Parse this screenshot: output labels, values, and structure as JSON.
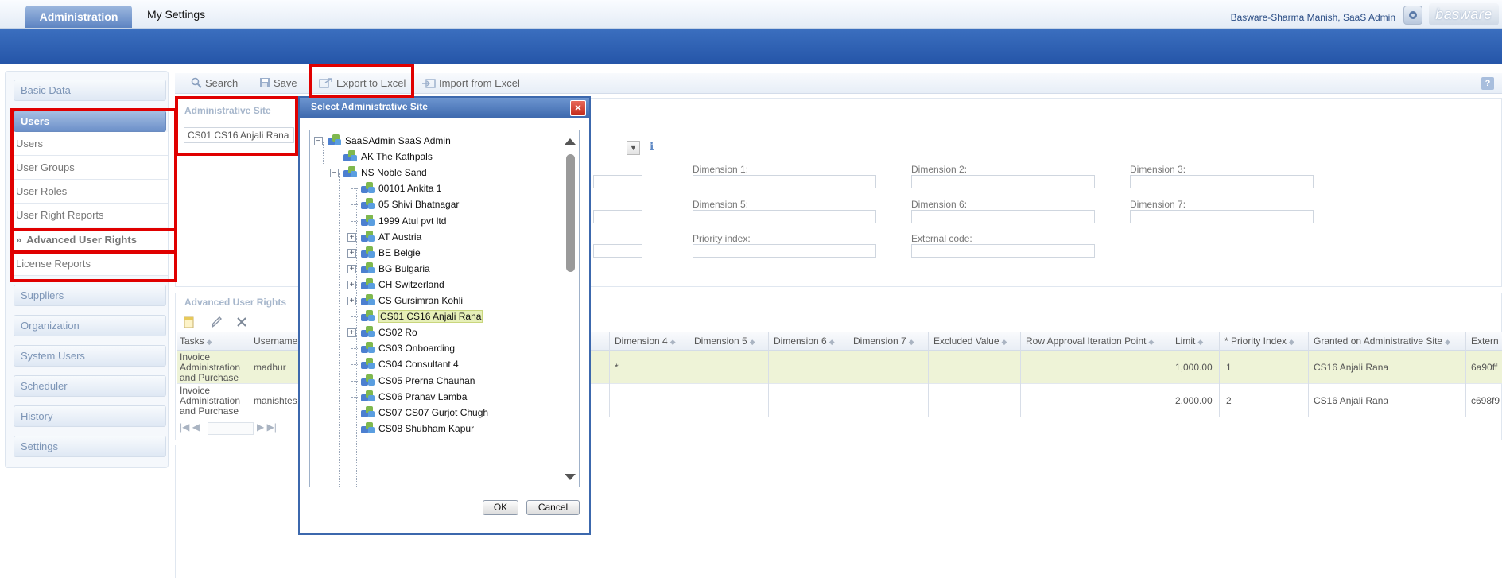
{
  "header": {
    "tabs": [
      {
        "label": "Administration",
        "active": true
      },
      {
        "label": "My Settings",
        "active": false
      }
    ],
    "user": "Basware-Sharma Manish, SaaS Admin",
    "logo_text": "basware"
  },
  "sidebar": {
    "items": [
      {
        "label": "Basic Data"
      },
      {
        "label": "Users"
      },
      {
        "label": "Suppliers"
      },
      {
        "label": "Organization"
      },
      {
        "label": "System Users"
      },
      {
        "label": "Scheduler"
      },
      {
        "label": "History"
      },
      {
        "label": "Settings"
      }
    ],
    "users_sub": [
      {
        "label": "Users"
      },
      {
        "label": "User Groups"
      },
      {
        "label": "User Roles"
      },
      {
        "label": "User Right Reports"
      },
      {
        "label": "Advanced User Rights"
      },
      {
        "label": "License Reports"
      }
    ],
    "selected_marker": "»"
  },
  "toolbar": {
    "search": "Search",
    "save": "Save",
    "export": "Export to Excel",
    "import": "Import from Excel",
    "help": "?"
  },
  "form": {
    "site_title": "Administrative Site",
    "site_value": "CS01 CS16 Anjali Rana",
    "labels": {
      "dim1": "Dimension 1:",
      "dim2": "Dimension 2:",
      "dim3": "Dimension 3:",
      "dim5": "Dimension 5:",
      "dim6": "Dimension 6:",
      "dim7": "Dimension 7:",
      "priority": "Priority index:",
      "external": "External code:"
    }
  },
  "grid": {
    "title": "Advanced User Rights",
    "columns": {
      "tasks": "Tasks",
      "username": "Username",
      "dim4": "Dimension 4",
      "dim5": "Dimension 5",
      "dim6": "Dimension 6",
      "dim7": "Dimension 7",
      "excluded": "Excluded Value",
      "row_approval": "Row Approval Iteration Point",
      "limit": "Limit",
      "priority": "* Priority Index",
      "granted": "Granted on Administrative Site",
      "external": "Extern"
    },
    "rows": [
      {
        "tasks": "Invoice Administration and Purchase",
        "username": "madhur",
        "dim4": "*",
        "limit": "1,000.00",
        "priority": "1",
        "granted": "CS16 Anjali Rana",
        "external": "6a90ff"
      },
      {
        "tasks": "Invoice Administration and Purchase",
        "username": "manishtes",
        "dim4": "",
        "limit": "2,000.00",
        "priority": "2",
        "granted": "CS16 Anjali Rana",
        "external": "c698f9"
      }
    ]
  },
  "dialog": {
    "title": "Select Administrative Site",
    "close": "×",
    "tree": [
      {
        "label": "SaaSAdmin SaaS Admin",
        "level": 0,
        "expander": "−"
      },
      {
        "label": "AK The Kathpals",
        "level": 1,
        "expander": ""
      },
      {
        "label": "NS Noble Sand",
        "level": 1,
        "expander": "−"
      },
      {
        "label": "00101 Ankita 1",
        "level": 2,
        "expander": ""
      },
      {
        "label": "05 Shivi Bhatnagar",
        "level": 2,
        "expander": ""
      },
      {
        "label": "1999 Atul pvt ltd",
        "level": 2,
        "expander": ""
      },
      {
        "label": "AT Austria",
        "level": 2,
        "expander": "+"
      },
      {
        "label": "BE Belgie",
        "level": 2,
        "expander": "+"
      },
      {
        "label": "BG Bulgaria",
        "level": 2,
        "expander": "+"
      },
      {
        "label": "CH Switzerland",
        "level": 2,
        "expander": "+"
      },
      {
        "label": "CS Gursimran Kohli",
        "level": 2,
        "expander": "+"
      },
      {
        "label": "CS01 CS16 Anjali Rana",
        "level": 2,
        "expander": "",
        "selected": true
      },
      {
        "label": "CS02 Ro",
        "level": 2,
        "expander": "+"
      },
      {
        "label": "CS03 Onboarding",
        "level": 2,
        "expander": ""
      },
      {
        "label": "CS04 Consultant 4",
        "level": 2,
        "expander": ""
      },
      {
        "label": "CS05 Prerna Chauhan",
        "level": 2,
        "expander": ""
      },
      {
        "label": "CS06 Pranav Lamba",
        "level": 2,
        "expander": ""
      },
      {
        "label": "CS07 CS07 Gurjot Chugh",
        "level": 2,
        "expander": ""
      },
      {
        "label": "CS08 Shubham Kapur",
        "level": 2,
        "expander": ""
      }
    ],
    "ok": "OK",
    "cancel": "Cancel"
  },
  "colors": {
    "accent": "#3c68ad",
    "banner": "#2555a8",
    "highlight": "#e00000",
    "selected_row": "#eef3d7"
  }
}
